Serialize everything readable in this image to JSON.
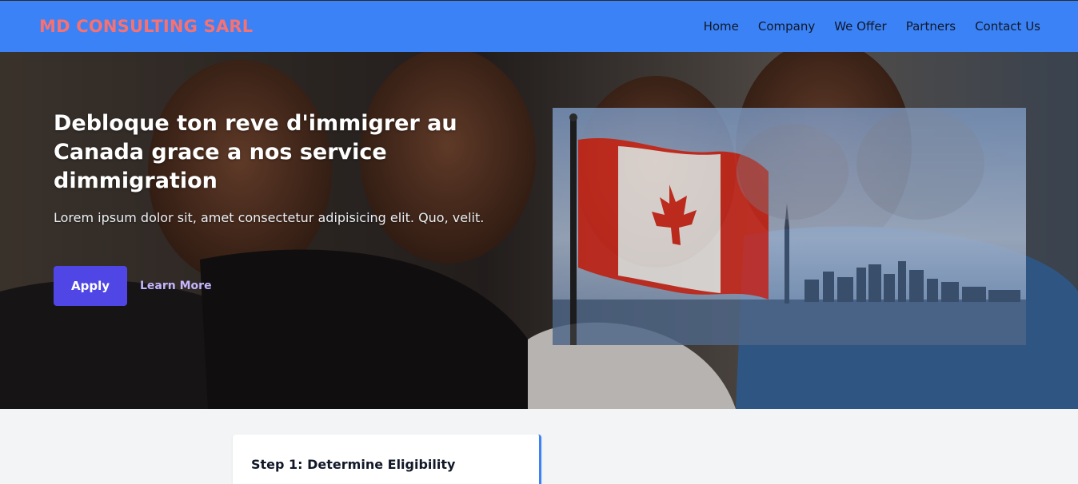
{
  "navbar": {
    "brand": "MD CONSULTING SARL",
    "links": [
      "Home",
      "Company",
      "We Offer",
      "Partners",
      "Contact Us"
    ]
  },
  "hero": {
    "title": "Debloque ton reve d'immigrer au Canada grace a nos service dimmigration",
    "subtitle": "Lorem ipsum dolor sit, amet consectetur adipisicing elit. Quo, velit.",
    "apply_label": "Apply",
    "learn_more_label": "Learn More"
  },
  "steps": [
    {
      "title": "Step 1: Determine Eligibility"
    }
  ],
  "colors": {
    "navbar": "#3b82f6",
    "brand": "#f87171",
    "apply": "#4f46e5",
    "learn_more": "#c4b5fd",
    "flag_red": "#d52b1e"
  }
}
